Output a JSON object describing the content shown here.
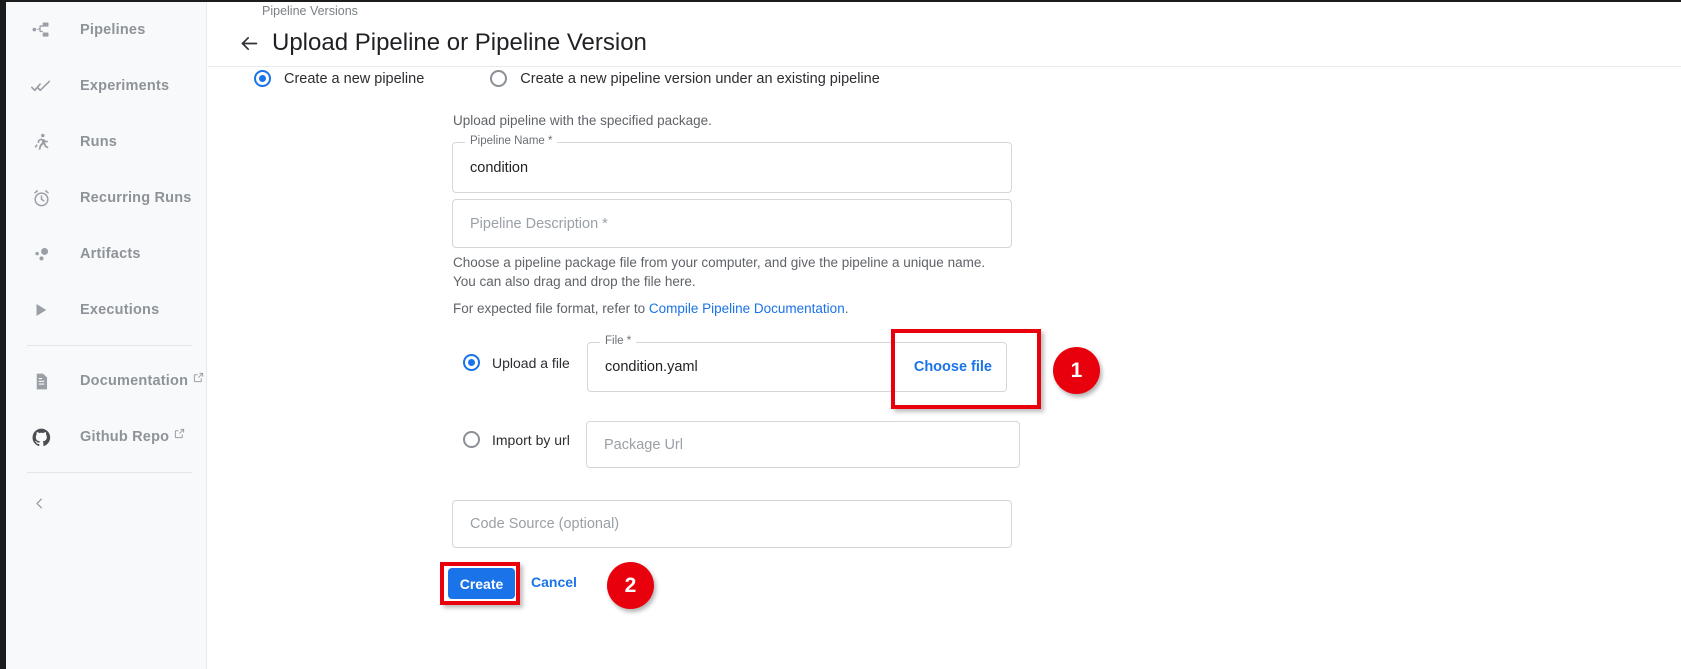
{
  "sidebar": {
    "items": [
      {
        "label": "Pipelines",
        "icon": "pipelines-icon",
        "external": false
      },
      {
        "label": "Experiments",
        "icon": "experiments-icon",
        "external": false
      },
      {
        "label": "Runs",
        "icon": "runs-icon",
        "external": false
      },
      {
        "label": "Recurring Runs",
        "icon": "recurring-runs-icon",
        "external": false
      },
      {
        "label": "Artifacts",
        "icon": "artifacts-icon",
        "external": false
      },
      {
        "label": "Executions",
        "icon": "executions-icon",
        "external": false
      }
    ],
    "links": [
      {
        "label": "Documentation",
        "icon": "document-icon",
        "external": true
      },
      {
        "label": "Github Repo",
        "icon": "github-icon",
        "external": true
      }
    ],
    "collapse_icon": "chevron-left-icon"
  },
  "header": {
    "breadcrumb": "Pipeline Versions",
    "back_icon": "arrow-left-icon",
    "title": "Upload Pipeline or Pipeline Version"
  },
  "mode": {
    "options": [
      {
        "label": "Create a new pipeline",
        "selected": true
      },
      {
        "label": "Create a new pipeline version under an existing pipeline",
        "selected": false
      }
    ]
  },
  "form": {
    "upload_hint": "Upload pipeline with the specified package.",
    "pipeline_name": {
      "legend": "Pipeline Name *",
      "value": "condition"
    },
    "pipeline_description": {
      "placeholder": "Pipeline Description *"
    },
    "choose_hint_line1": "Choose a pipeline package file from your computer, and give the pipeline a unique name.",
    "choose_hint_line2": "You can also drag and drop the file here.",
    "format_hint_prefix": "For expected file format, refer to ",
    "format_hint_link": "Compile Pipeline Documentation",
    "format_hint_suffix": ".",
    "upload_a_file": {
      "label": "Upload a file",
      "selected": true,
      "legend": "File *",
      "value": "condition.yaml",
      "choose_file_label": "Choose file"
    },
    "import_by_url": {
      "label": "Import by url",
      "selected": false,
      "placeholder": "Package Url"
    },
    "code_source": {
      "placeholder": "Code Source (optional)"
    },
    "create_label": "Create",
    "cancel_label": "Cancel"
  },
  "annotations": [
    {
      "id": "1",
      "target": "choose-file-button"
    },
    {
      "id": "2",
      "target": "create-button"
    }
  ],
  "colors": {
    "accent_blue": "#1a73e8",
    "annotation_red": "#e8000d",
    "sidebar_bg": "#f8f9fa",
    "text_muted": "#8d9399"
  }
}
